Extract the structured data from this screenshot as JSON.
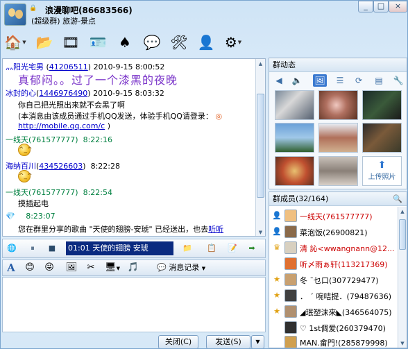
{
  "window": {
    "title": "浪漫聊吧(86683566)",
    "subtitle": "(超级群) 旅游-景点",
    "controls": [
      "_",
      "□",
      "×"
    ]
  },
  "toolbar": {
    "icons": [
      "home-icon",
      "folder-icon",
      "film-icon",
      "card-icon",
      "apps-icon",
      "message-icon",
      "tools-icon",
      "user-settings-icon",
      "gear-icon"
    ]
  },
  "chat": {
    "lines": [
      {
        "sender": "灬阳光宅男",
        "id": "41206511",
        "time": "2010-9-15 8:00:52"
      },
      {
        "text": "真郁闷。。过了一个漆黑的夜晚"
      },
      {
        "sender": "冰封的心",
        "id": "1446976490",
        "time": "2010-9-15 8:03:32"
      },
      {
        "text": "你自己把光照出来就不会黑了啊"
      },
      {
        "text": "(本消息由该成员通过手机QQ发送，体验手机QQ请登录："
      },
      {
        "link": "http://mobile.qq.com/c"
      },
      {
        "link_close": ")"
      },
      {
        "sender": "一线天",
        "id": "761577777",
        "time": "8:22:16"
      },
      {
        "sender": "海纳百川",
        "id": "434526603",
        "time": "8:22:28"
      },
      {
        "sender": "一线天",
        "id": "761577777",
        "time": "8:22:54"
      },
      {
        "text": "摸插起电"
      },
      {
        "time": "8:23:07"
      },
      {
        "text": "您在群里分享的歌曲 \"天使的翅膀-安琥\" 已经送出，也去",
        "link": "听听"
      }
    ],
    "emoji_label": "^_^"
  },
  "music": {
    "track": "01:01 天使的翅膀  安琥",
    "play_icon": "⏸",
    "stop_icon": "■"
  },
  "format": {
    "font_label": "A",
    "history_label": "消息记录"
  },
  "buttons": {
    "close": "关闭(C)",
    "send": "发送(S)"
  },
  "dynamics": {
    "title": "群动态",
    "upload_label": "上传照片"
  },
  "members": {
    "title": "群成员(32/164)",
    "list": [
      {
        "name": "一线天(761577777)",
        "color": "#cc0000"
      },
      {
        "name": "菜泡饭(26900821)",
        "color": "#000000"
      },
      {
        "name": "清  訫<wwangnann@12...",
        "color": "#cc0000"
      },
      {
        "name": "听〆雨ぁ轩(113217369)",
        "color": "#cc0000"
      },
      {
        "name": "冬 ˉ乜口(307729477)",
        "color": "#000000"
      },
      {
        "name": "．  ˊ  啘咭提．(79487636)",
        "color": "#000000"
      },
      {
        "name": "◢珉塑沫來◣(346564075)",
        "color": "#000000"
      },
      {
        "name": "♡ 1st倜爱(260379470)",
        "color": "#000000"
      },
      {
        "name": "MAN.畲門!(285879998)",
        "color": "#000000"
      }
    ]
  }
}
